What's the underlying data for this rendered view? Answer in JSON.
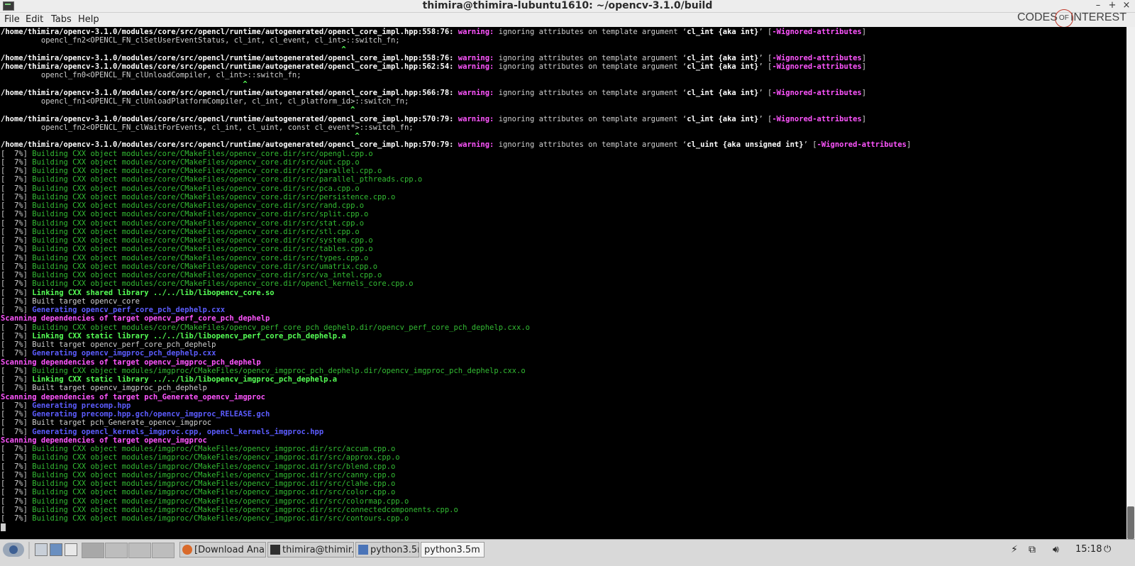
{
  "window": {
    "title": "thimira@thimira-lubuntu1610: ~/opencv-3.1.0/build",
    "controls": [
      "–",
      "+",
      "×"
    ]
  },
  "menu": [
    "File",
    "Edit",
    "Tabs",
    "Help"
  ],
  "watermark": {
    "left": "CODES",
    "of": "OF",
    "right": "INTEREST"
  },
  "terminal": [
    [
      [
        "w",
        "/home/thimira/opencv-3.1.0/modules/core/src/opencl/runtime/autogenerated/opencl_core_impl.hpp:558:76: "
      ],
      [
        "warn",
        "warning:"
      ],
      [
        "t",
        " ignoring attributes on template argument ‘"
      ],
      [
        "w",
        "cl_int {aka int}"
      ],
      [
        "t",
        "’ ["
      ],
      [
        "warn",
        "-Wignored-attributes"
      ],
      [
        "t",
        "]"
      ]
    ],
    [
      [
        "t",
        "         opencl_fn2<OPENCL_FN_clSetUserEventStatus, cl_int, cl_event, cl_int>::switch_fn;"
      ]
    ],
    [
      [
        "caret",
        "                                                                            ^"
      ]
    ],
    [
      [
        "w",
        "/home/thimira/opencv-3.1.0/modules/core/src/opencl/runtime/autogenerated/opencl_core_impl.hpp:558:76: "
      ],
      [
        "warn",
        "warning:"
      ],
      [
        "t",
        " ignoring attributes on template argument ‘"
      ],
      [
        "w",
        "cl_int {aka int}"
      ],
      [
        "t",
        "’ ["
      ],
      [
        "warn",
        "-Wignored-attributes"
      ],
      [
        "t",
        "]"
      ]
    ],
    [
      [
        "w",
        "/home/thimira/opencv-3.1.0/modules/core/src/opencl/runtime/autogenerated/opencl_core_impl.hpp:562:54: "
      ],
      [
        "warn",
        "warning:"
      ],
      [
        "t",
        " ignoring attributes on template argument ‘"
      ],
      [
        "w",
        "cl_int {aka int}"
      ],
      [
        "t",
        "’ ["
      ],
      [
        "warn",
        "-Wignored-attributes"
      ],
      [
        "t",
        "]"
      ]
    ],
    [
      [
        "t",
        "         opencl_fn0<OPENCL_FN_clUnloadCompiler, cl_int>::switch_fn;"
      ]
    ],
    [
      [
        "caret",
        "                                                      ^"
      ]
    ],
    [
      [
        "w",
        "/home/thimira/opencv-3.1.0/modules/core/src/opencl/runtime/autogenerated/opencl_core_impl.hpp:566:78: "
      ],
      [
        "warn",
        "warning:"
      ],
      [
        "t",
        " ignoring attributes on template argument ‘"
      ],
      [
        "w",
        "cl_int {aka int}"
      ],
      [
        "t",
        "’ ["
      ],
      [
        "warn",
        "-Wignored-attributes"
      ],
      [
        "t",
        "]"
      ]
    ],
    [
      [
        "t",
        "         opencl_fn1<OPENCL_FN_clUnloadPlatformCompiler, cl_int, cl_platform_id>::switch_fn;"
      ]
    ],
    [
      [
        "caret",
        "                                                                              ^"
      ]
    ],
    [
      [
        "w",
        "/home/thimira/opencv-3.1.0/modules/core/src/opencl/runtime/autogenerated/opencl_core_impl.hpp:570:79: "
      ],
      [
        "warn",
        "warning:"
      ],
      [
        "t",
        " ignoring attributes on template argument ‘"
      ],
      [
        "w",
        "cl_int {aka int}"
      ],
      [
        "t",
        "’ ["
      ],
      [
        "warn",
        "-Wignored-attributes"
      ],
      [
        "t",
        "]"
      ]
    ],
    [
      [
        "t",
        "         opencl_fn2<OPENCL_FN_clWaitForEvents, cl_int, cl_uint, const cl_event*>::switch_fn;"
      ]
    ],
    [
      [
        "caret",
        "                                                                               ^"
      ]
    ],
    [
      [
        "w",
        "/home/thimira/opencv-3.1.0/modules/core/src/opencl/runtime/autogenerated/opencl_core_impl.hpp:570:79: "
      ],
      [
        "warn",
        "warning:"
      ],
      [
        "t",
        " ignoring attributes on template argument ‘"
      ],
      [
        "w",
        "cl_uint {aka unsigned int}"
      ],
      [
        "t",
        "’ ["
      ],
      [
        "warn",
        "-Wignored-attributes"
      ],
      [
        "t",
        "]"
      ]
    ],
    [
      [
        "t",
        "[  7%] "
      ],
      [
        "grn",
        "Building CXX object modules/core/CMakeFiles/opencv_core.dir/src/opengl.cpp.o"
      ]
    ],
    [
      [
        "t",
        "[  7%] "
      ],
      [
        "grn",
        "Building CXX object modules/core/CMakeFiles/opencv_core.dir/src/out.cpp.o"
      ]
    ],
    [
      [
        "t",
        "[  7%] "
      ],
      [
        "grn",
        "Building CXX object modules/core/CMakeFiles/opencv_core.dir/src/parallel.cpp.o"
      ]
    ],
    [
      [
        "t",
        "[  7%] "
      ],
      [
        "grn",
        "Building CXX object modules/core/CMakeFiles/opencv_core.dir/src/parallel_pthreads.cpp.o"
      ]
    ],
    [
      [
        "t",
        "[  7%] "
      ],
      [
        "grn",
        "Building CXX object modules/core/CMakeFiles/opencv_core.dir/src/pca.cpp.o"
      ]
    ],
    [
      [
        "t",
        "[  7%] "
      ],
      [
        "grn",
        "Building CXX object modules/core/CMakeFiles/opencv_core.dir/src/persistence.cpp.o"
      ]
    ],
    [
      [
        "t",
        "[  7%] "
      ],
      [
        "grn",
        "Building CXX object modules/core/CMakeFiles/opencv_core.dir/src/rand.cpp.o"
      ]
    ],
    [
      [
        "t",
        "[  7%] "
      ],
      [
        "grn",
        "Building CXX object modules/core/CMakeFiles/opencv_core.dir/src/split.cpp.o"
      ]
    ],
    [
      [
        "t",
        "[  7%] "
      ],
      [
        "grn",
        "Building CXX object modules/core/CMakeFiles/opencv_core.dir/src/stat.cpp.o"
      ]
    ],
    [
      [
        "t",
        "[  7%] "
      ],
      [
        "grn",
        "Building CXX object modules/core/CMakeFiles/opencv_core.dir/src/stl.cpp.o"
      ]
    ],
    [
      [
        "t",
        "[  7%] "
      ],
      [
        "grn",
        "Building CXX object modules/core/CMakeFiles/opencv_core.dir/src/system.cpp.o"
      ]
    ],
    [
      [
        "t",
        "[  7%] "
      ],
      [
        "grn",
        "Building CXX object modules/core/CMakeFiles/opencv_core.dir/src/tables.cpp.o"
      ]
    ],
    [
      [
        "t",
        "[  7%] "
      ],
      [
        "grn",
        "Building CXX object modules/core/CMakeFiles/opencv_core.dir/src/types.cpp.o"
      ]
    ],
    [
      [
        "t",
        "[  7%] "
      ],
      [
        "grn",
        "Building CXX object modules/core/CMakeFiles/opencv_core.dir/src/umatrix.cpp.o"
      ]
    ],
    [
      [
        "t",
        "[  7%] "
      ],
      [
        "grn",
        "Building CXX object modules/core/CMakeFiles/opencv_core.dir/src/va_intel.cpp.o"
      ]
    ],
    [
      [
        "t",
        "[  7%] "
      ],
      [
        "grn",
        "Building CXX object modules/core/CMakeFiles/opencv_core.dir/opencl_kernels_core.cpp.o"
      ]
    ],
    [
      [
        "t",
        "[  7%] "
      ],
      [
        "lgrn",
        "Linking CXX shared library ../../lib/libopencv_core.so"
      ]
    ],
    [
      [
        "t",
        "[  7%] Built target opencv_core"
      ]
    ],
    [
      [
        "t",
        "[  7%] "
      ],
      [
        "blu",
        "Generating opencv_perf_core_pch_dephelp.cxx"
      ]
    ],
    [
      [
        "mag",
        "Scanning dependencies of target opencv_perf_core_pch_dephelp"
      ]
    ],
    [
      [
        "t",
        "[  7%] "
      ],
      [
        "grn",
        "Building CXX object modules/core/CMakeFiles/opencv_perf_core_pch_dephelp.dir/opencv_perf_core_pch_dephelp.cxx.o"
      ]
    ],
    [
      [
        "t",
        "[  7%] "
      ],
      [
        "lgrn",
        "Linking CXX static library ../../lib/libopencv_perf_core_pch_dephelp.a"
      ]
    ],
    [
      [
        "t",
        "[  7%] Built target opencv_perf_core_pch_dephelp"
      ]
    ],
    [
      [
        "t",
        "[  7%] "
      ],
      [
        "blu",
        "Generating opencv_imgproc_pch_dephelp.cxx"
      ]
    ],
    [
      [
        "mag",
        "Scanning dependencies of target opencv_imgproc_pch_dephelp"
      ]
    ],
    [
      [
        "t",
        "[  7%] "
      ],
      [
        "grn",
        "Building CXX object modules/imgproc/CMakeFiles/opencv_imgproc_pch_dephelp.dir/opencv_imgproc_pch_dephelp.cxx.o"
      ]
    ],
    [
      [
        "t",
        "[  7%] "
      ],
      [
        "lgrn",
        "Linking CXX static library ../../lib/libopencv_imgproc_pch_dephelp.a"
      ]
    ],
    [
      [
        "t",
        "[  7%] Built target opencv_imgproc_pch_dephelp"
      ]
    ],
    [
      [
        "mag",
        "Scanning dependencies of target pch_Generate_opencv_imgproc"
      ]
    ],
    [
      [
        "t",
        "[  7%] "
      ],
      [
        "blu",
        "Generating precomp.hpp"
      ]
    ],
    [
      [
        "t",
        "[  7%] "
      ],
      [
        "blu",
        "Generating precomp.hpp.gch/opencv_imgproc_RELEASE.gch"
      ]
    ],
    [
      [
        "t",
        "[  7%] Built target pch_Generate_opencv_imgproc"
      ]
    ],
    [
      [
        "t",
        "[  7%] "
      ],
      [
        "blu",
        "Generating opencl_kernels_imgproc.cpp, opencl_kernels_imgproc.hpp"
      ]
    ],
    [
      [
        "mag",
        "Scanning dependencies of target opencv_imgproc"
      ]
    ],
    [
      [
        "t",
        "[  7%] "
      ],
      [
        "grn",
        "Building CXX object modules/imgproc/CMakeFiles/opencv_imgproc.dir/src/accum.cpp.o"
      ]
    ],
    [
      [
        "t",
        "[  7%] "
      ],
      [
        "grn",
        "Building CXX object modules/imgproc/CMakeFiles/opencv_imgproc.dir/src/approx.cpp.o"
      ]
    ],
    [
      [
        "t",
        "[  7%] "
      ],
      [
        "grn",
        "Building CXX object modules/imgproc/CMakeFiles/opencv_imgproc.dir/src/blend.cpp.o"
      ]
    ],
    [
      [
        "t",
        "[  7%] "
      ],
      [
        "grn",
        "Building CXX object modules/imgproc/CMakeFiles/opencv_imgproc.dir/src/canny.cpp.o"
      ]
    ],
    [
      [
        "t",
        "[  7%] "
      ],
      [
        "grn",
        "Building CXX object modules/imgproc/CMakeFiles/opencv_imgproc.dir/src/clahe.cpp.o"
      ]
    ],
    [
      [
        "t",
        "[  7%] "
      ],
      [
        "grn",
        "Building CXX object modules/imgproc/CMakeFiles/opencv_imgproc.dir/src/color.cpp.o"
      ]
    ],
    [
      [
        "t",
        "[  7%] "
      ],
      [
        "grn",
        "Building CXX object modules/imgproc/CMakeFiles/opencv_imgproc.dir/src/colormap.cpp.o"
      ]
    ],
    [
      [
        "t",
        "[  7%] "
      ],
      [
        "grn",
        "Building CXX object modules/imgproc/CMakeFiles/opencv_imgproc.dir/src/connectedcomponents.cpp.o"
      ]
    ],
    [
      [
        "t",
        "[  7%] "
      ],
      [
        "grn",
        "Building CXX object modules/imgproc/CMakeFiles/opencv_imgproc.dir/src/contours.cpp.o"
      ]
    ]
  ],
  "taskbar": {
    "tasks": [
      {
        "label": "[Download Ana...",
        "icon": "firefox-icon",
        "color": "#d96a2b"
      },
      {
        "label": "thimira@thimir...",
        "icon": "terminal-icon",
        "color": "#2f2f2f"
      },
      {
        "label": "python3.5m",
        "icon": "window-icon",
        "color": "#4a74b8"
      },
      {
        "label": "python3.5m",
        "icon": "",
        "color": ""
      }
    ],
    "clock": "15:18"
  },
  "colors": {
    "terminal_bg": "#000000",
    "warning": "#ff55ff",
    "build": "#33bb33",
    "link": "#55ff55",
    "generate": "#5c5cff"
  }
}
